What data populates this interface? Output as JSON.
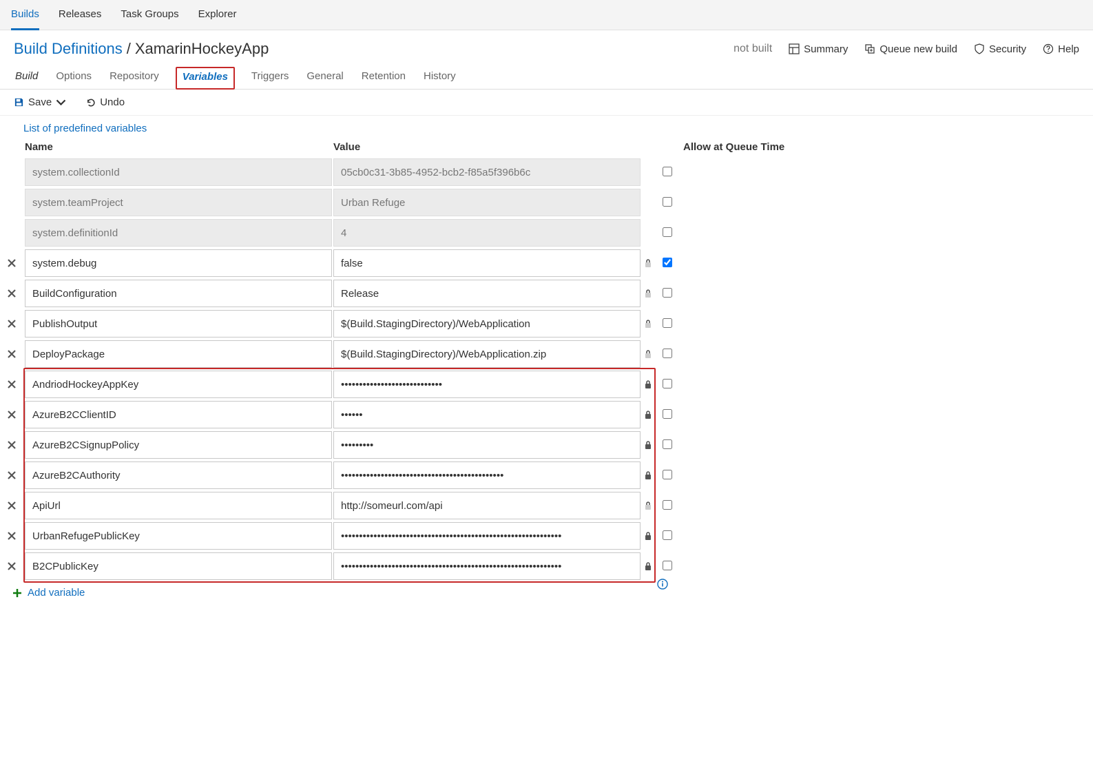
{
  "topNav": {
    "tabs": [
      "Builds",
      "Releases",
      "Task Groups",
      "Explorer"
    ],
    "activeIndex": 0
  },
  "breadcrumb": {
    "root": "Build Definitions",
    "sep": "/",
    "name": "XamarinHockeyApp"
  },
  "headerStatus": "not built",
  "headerActions": {
    "summary": "Summary",
    "queue": "Queue new build",
    "security": "Security",
    "help": "Help"
  },
  "subNav": {
    "tabs": [
      "Build",
      "Options",
      "Repository",
      "Variables",
      "Triggers",
      "General",
      "Retention",
      "History"
    ],
    "activeIndex": 3
  },
  "toolbar": {
    "save": "Save",
    "undo": "Undo"
  },
  "predefLink": "List of predefined variables",
  "columns": {
    "name": "Name",
    "value": "Value",
    "allow": "Allow at Queue Time"
  },
  "variables": [
    {
      "name": "system.collectionId",
      "value": "05cb0c31-3b85-4952-bcb2-f85a5f396b6c",
      "system": true,
      "locked": null,
      "allow": false,
      "deletable": false,
      "highlight": false
    },
    {
      "name": "system.teamProject",
      "value": "Urban Refuge",
      "system": true,
      "locked": null,
      "allow": false,
      "deletable": false,
      "highlight": false
    },
    {
      "name": "system.definitionId",
      "value": "4",
      "system": true,
      "locked": null,
      "allow": false,
      "deletable": false,
      "highlight": false
    },
    {
      "name": "system.debug",
      "value": "false",
      "system": false,
      "locked": "dim",
      "allow": true,
      "deletable": true,
      "highlight": false
    },
    {
      "name": "BuildConfiguration",
      "value": "Release",
      "system": false,
      "locked": "dim",
      "allow": false,
      "deletable": true,
      "highlight": false
    },
    {
      "name": "PublishOutput",
      "value": "$(Build.StagingDirectory)/WebApplication",
      "system": false,
      "locked": "dim",
      "allow": false,
      "deletable": true,
      "highlight": false
    },
    {
      "name": "DeployPackage",
      "value": "$(Build.StagingDirectory)/WebApplication.zip",
      "system": false,
      "locked": "dim",
      "allow": false,
      "deletable": true,
      "highlight": false
    },
    {
      "name": "AndriodHockeyAppKey",
      "value": "••••••••••••••••••••••••••••",
      "system": false,
      "locked": "dark",
      "allow": false,
      "deletable": true,
      "highlight": true
    },
    {
      "name": "AzureB2CClientID",
      "value": "••••••",
      "system": false,
      "locked": "dark",
      "allow": false,
      "deletable": true,
      "highlight": true
    },
    {
      "name": "AzureB2CSignupPolicy",
      "value": "•••••••••",
      "system": false,
      "locked": "dark",
      "allow": false,
      "deletable": true,
      "highlight": true
    },
    {
      "name": "AzureB2CAuthority",
      "value": "•••••••••••••••••••••••••••••••••••••••••••••",
      "system": false,
      "locked": "dark",
      "allow": false,
      "deletable": true,
      "highlight": true
    },
    {
      "name": "ApiUrl",
      "value": "http://someurl.com/api",
      "system": false,
      "locked": "dim",
      "allow": false,
      "deletable": true,
      "highlight": true
    },
    {
      "name": "UrbanRefugePublicKey",
      "value": "•••••••••••••••••••••••••••••••••••••••••••••••••••••••••••••",
      "system": false,
      "locked": "dark",
      "allow": false,
      "deletable": true,
      "highlight": true
    },
    {
      "name": "B2CPublicKey",
      "value": "•••••••••••••••••••••••••••••••••••••••••••••••••••••••••••••",
      "system": false,
      "locked": "dark",
      "allow": false,
      "deletable": true,
      "highlight": true
    }
  ],
  "addVariable": "Add variable"
}
